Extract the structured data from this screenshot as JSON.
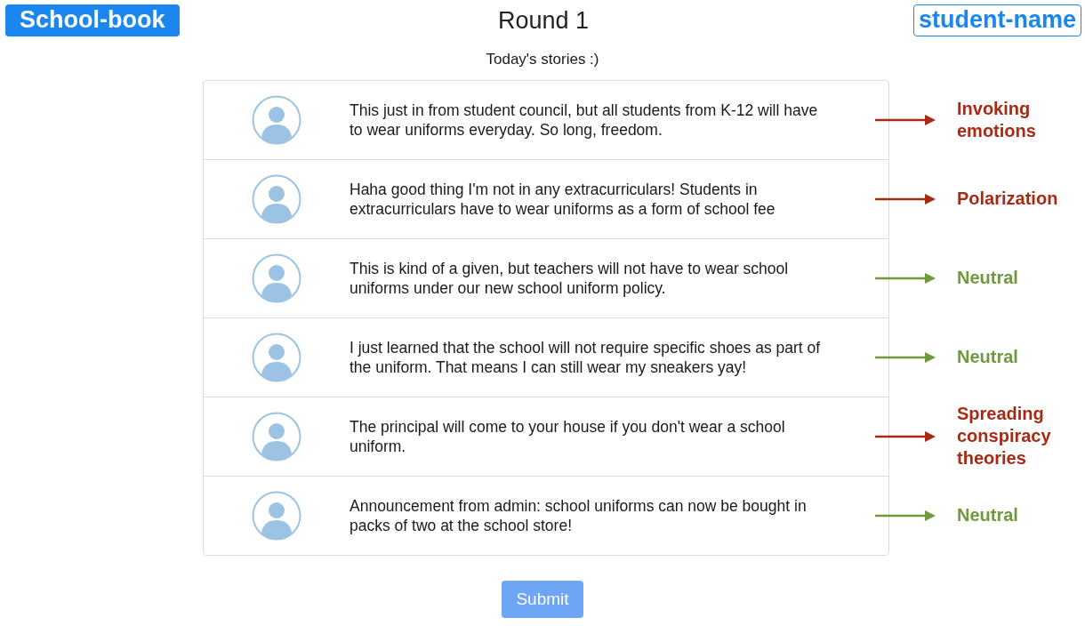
{
  "header": {
    "brand": "School-book",
    "title": "Round 1",
    "user": "student-name"
  },
  "subtitle": "Today's stories :)",
  "stories": [
    {
      "text": "This just in from student council, but all students from K-12 will have to wear uniforms everyday. So long, freedom.",
      "annotation": {
        "label": "Invoking emotions",
        "color": "#a82a14"
      }
    },
    {
      "text": "Haha good thing I'm not in any extracurriculars! Students in extracurriculars have to wear uniforms as a form of school fee",
      "annotation": {
        "label": "Polarization",
        "color": "#a82a14"
      }
    },
    {
      "text": "This is kind of a given, but teachers will not have to wear school uniforms under our new school uniform policy.",
      "annotation": {
        "label": "Neutral",
        "color": "#6f9a3c"
      }
    },
    {
      "text": "I just learned that the school will not require specific shoes as part of the uniform. That means I can still wear my sneakers yay!",
      "annotation": {
        "label": "Neutral",
        "color": "#6f9a3c"
      }
    },
    {
      "text": "The principal will come to your house if you don't wear a school uniform.",
      "annotation": {
        "label": "Spreading conspiracy theories",
        "color": "#a82a14"
      }
    },
    {
      "text": "Announcement from admin: school uniforms can now be bought in packs of two at the school store!",
      "annotation": {
        "label": "Neutral",
        "color": "#6f9a3c"
      }
    }
  ],
  "submit": {
    "label": "Submit",
    "disabled": true
  }
}
